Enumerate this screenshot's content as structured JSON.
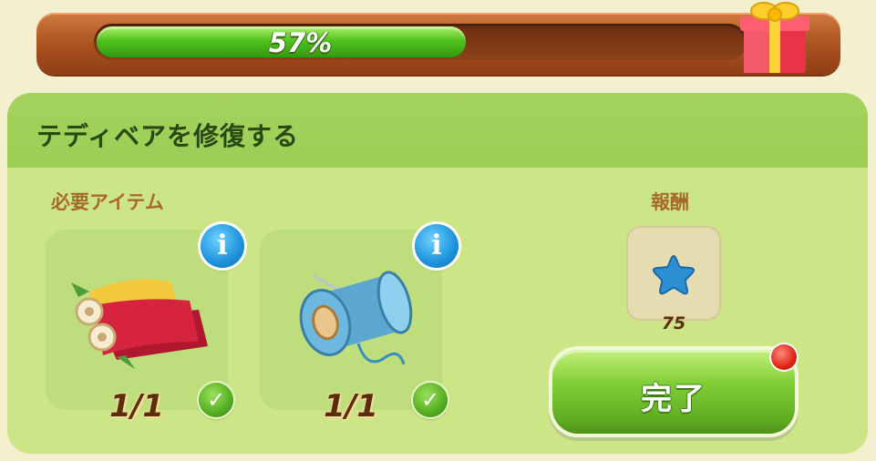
{
  "progress": {
    "percent_label": "57%",
    "fraction": 0.57,
    "gift_icon": "gift-box-icon"
  },
  "task": {
    "title": "テディベアを修復する",
    "required_label": "必要アイテム",
    "reward_label": "報酬",
    "items": [
      {
        "name": "fabric-rolls",
        "icon": "fabric-rolls-icon",
        "count": "1/1",
        "complete": true
      },
      {
        "name": "thread-spool",
        "icon": "thread-spool-icon",
        "count": "1/1",
        "complete": true
      }
    ],
    "reward": {
      "icon": "blue-star-icon",
      "value": "75"
    },
    "complete_button": "完了"
  },
  "colors": {
    "panel": "#b3de72",
    "progress_fill": "#52c21f",
    "frame": "#a9501f",
    "info": "#1d93dc"
  }
}
